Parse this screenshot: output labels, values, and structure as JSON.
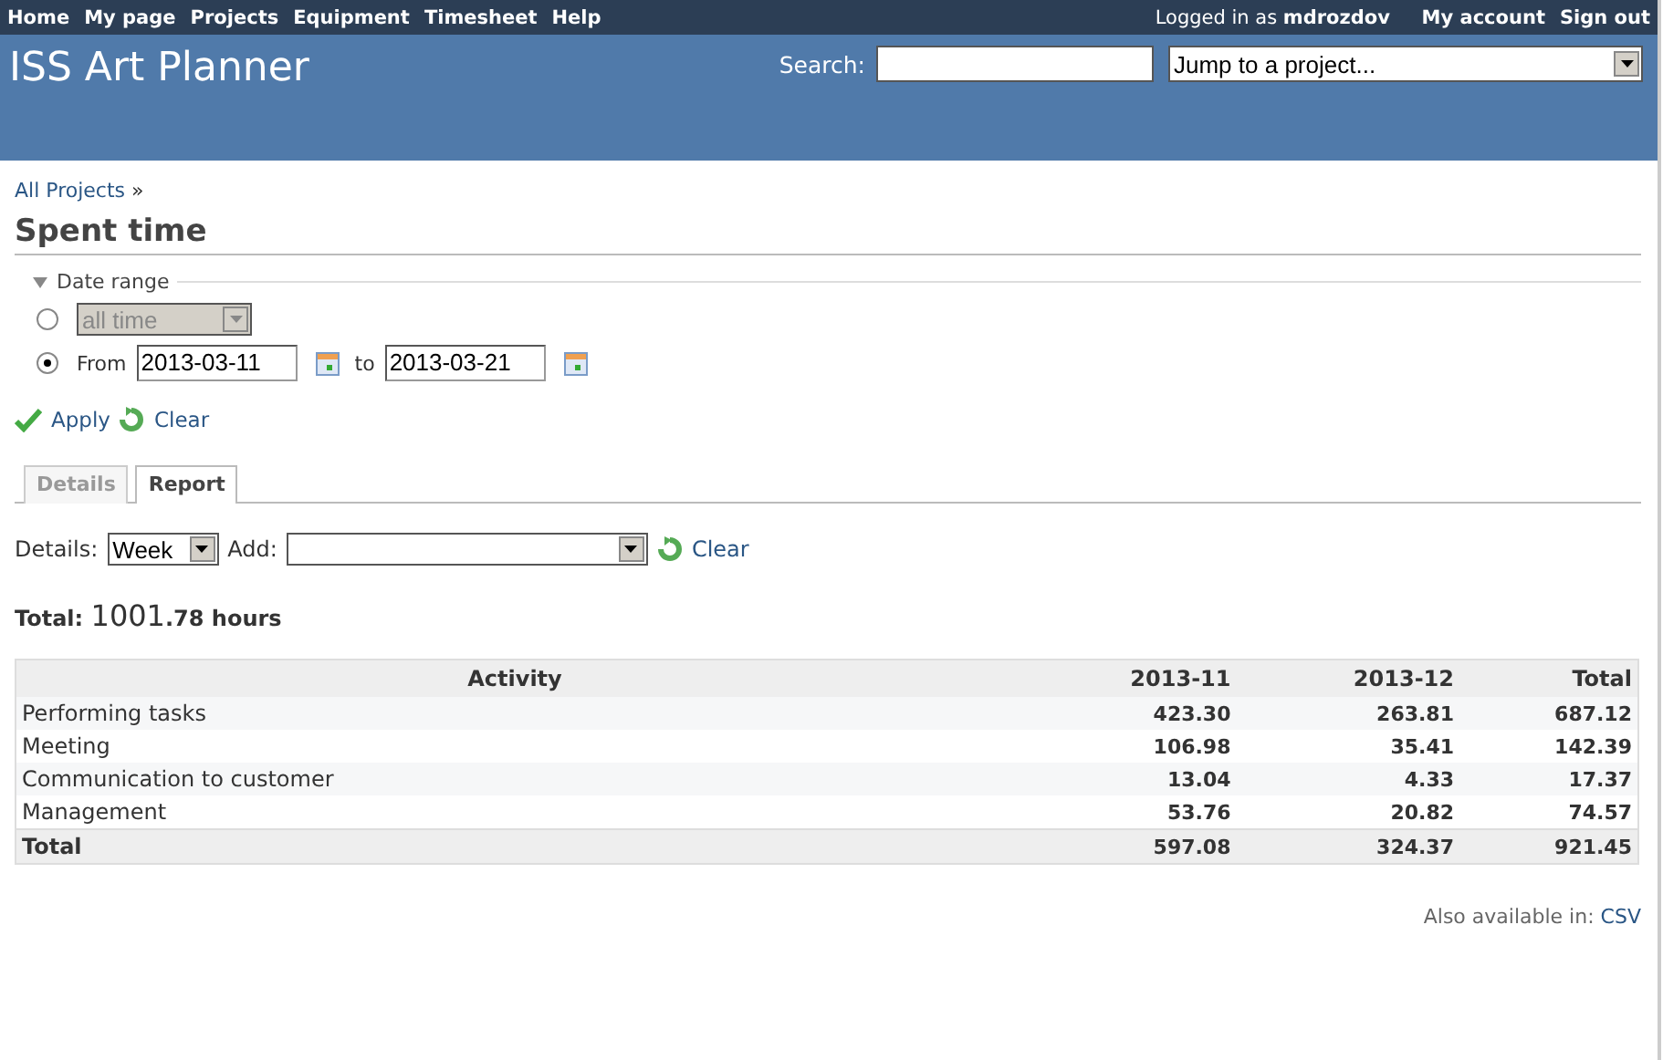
{
  "top_menu": [
    "Home",
    "My page",
    "Projects",
    "Equipment",
    "Timesheet",
    "Help"
  ],
  "account": {
    "logged_in_label": "Logged in as",
    "user": "mdrozdov",
    "links": [
      "My account",
      "Sign out"
    ]
  },
  "header": {
    "title": "ISS Art Planner",
    "search_label": "Search:",
    "project_jump": "Jump to a project..."
  },
  "breadcrumb": {
    "link": "All Projects",
    "separator": "»"
  },
  "page_title": "Spent time",
  "date_range": {
    "legend": "Date range",
    "expanded": true,
    "options": [
      {
        "kind": "period",
        "selected": false,
        "value": "all time",
        "disabled": true
      },
      {
        "kind": "range",
        "selected": true,
        "from_label": "From",
        "from": "2013-03-11",
        "to_label": "to",
        "to": "2013-03-21"
      }
    ]
  },
  "actions": [
    "Apply",
    "Clear"
  ],
  "tabs": [
    {
      "label": "Details",
      "selected": false
    },
    {
      "label": "Report",
      "selected": true
    }
  ],
  "report_options": {
    "details_label": "Details:",
    "details_value": "Week",
    "add_label": "Add:",
    "clear": "Clear"
  },
  "total": {
    "label": "Total:",
    "hours_whole": "1001",
    "hours_rest": ".78 hours"
  },
  "table": {
    "columns": [
      "Activity",
      "2013-11",
      "2013-12",
      "Total"
    ],
    "rows": [
      [
        "Performing tasks",
        "423.30",
        "263.81",
        "687.12"
      ],
      [
        "Meeting",
        "106.98",
        "35.41",
        "142.39"
      ],
      [
        "Communication to customer",
        "13.04",
        "4.33",
        "17.37"
      ],
      [
        "Management",
        "53.76",
        "20.82",
        "74.57"
      ]
    ],
    "total_row": [
      "Total",
      "597.08",
      "324.37",
      "921.45"
    ]
  },
  "other_formats": {
    "label": "Also available in:",
    "link": "CSV"
  }
}
